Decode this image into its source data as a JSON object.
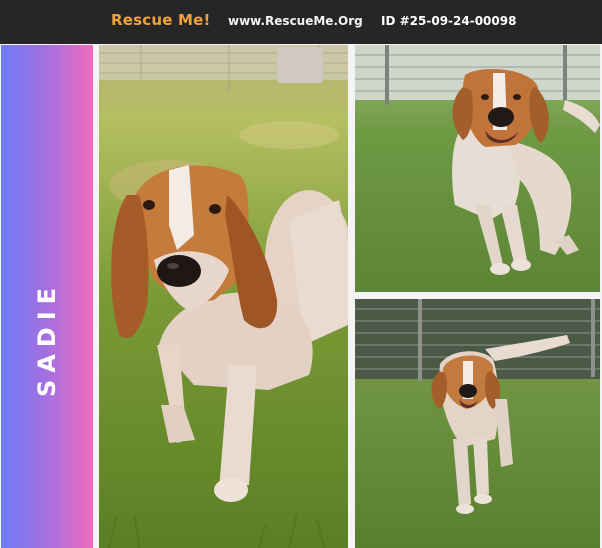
{
  "header": {
    "brand": "Rescue Me!",
    "site": "www.RescueMe.Org",
    "pet_id": "ID #25-09-24-00098"
  },
  "pet": {
    "name": "SADIE"
  },
  "colors": {
    "header_bg": "#262626",
    "brand_orange": "#f0a23a",
    "gradient_start": "#6f7cf6",
    "gradient_end": "#f26bbd"
  },
  "photos": [
    {
      "subject": "close-up of hound dog standing in sunlit grass"
    },
    {
      "subject": "hound dog running toward camera by chain-link fence"
    },
    {
      "subject": "hound dog running on grass, tail raised"
    }
  ]
}
